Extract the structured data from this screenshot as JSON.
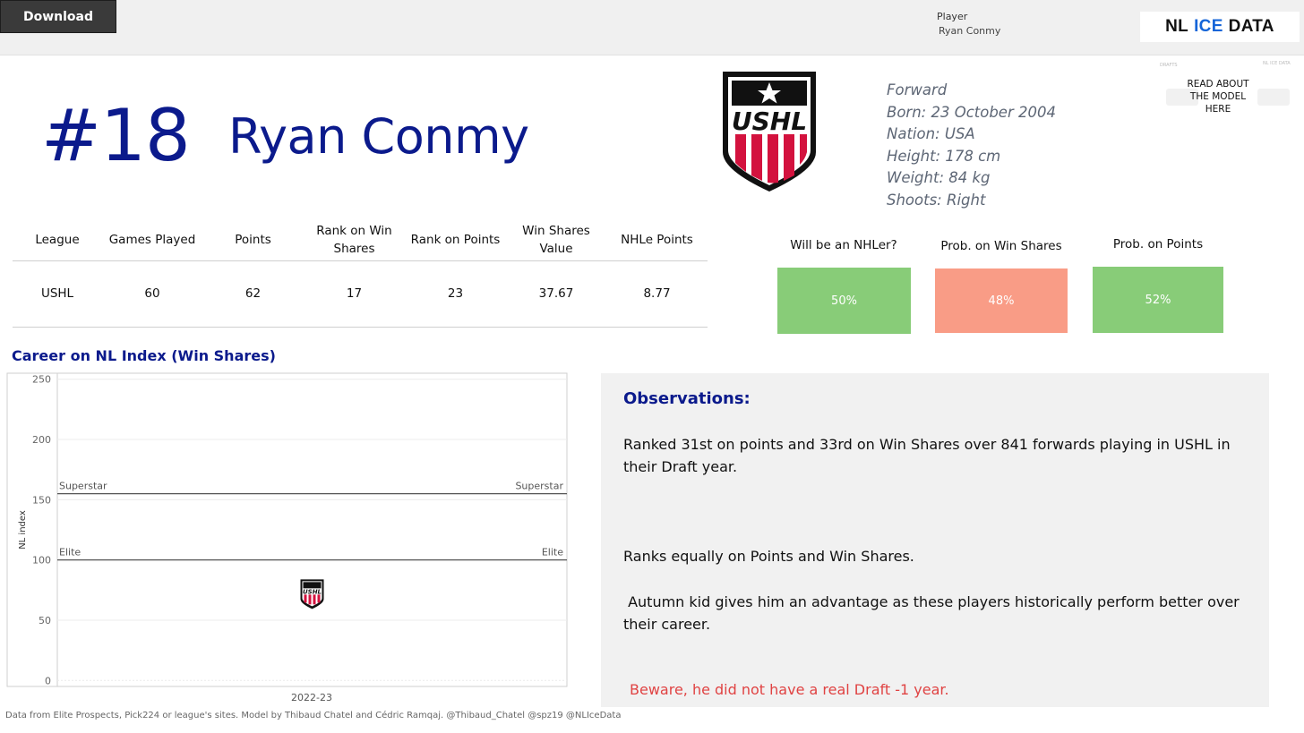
{
  "toolbar": {
    "download_label": "Download"
  },
  "filter": {
    "label": "Player",
    "value": "Ryan Conmy"
  },
  "brand": {
    "part1": "NL",
    "part2": "ICE",
    "part3": "DATA"
  },
  "player": {
    "number": "#18",
    "name": "Ryan Conmy",
    "league_logo_text": "USHL",
    "bio": [
      "Forward",
      "Born: 23 October 2004",
      "Nation: USA",
      "Height: 178 cm",
      "Weight: 84 kg",
      "Shoots: Right"
    ]
  },
  "read_about": {
    "label": "READ ABOUT THE MODEL HERE",
    "tiny_left": "DRAFTS",
    "tiny_right": "NL ICE DATA"
  },
  "stats": {
    "headers": [
      "League",
      "Games Played",
      "Points",
      "Rank on Win Shares",
      "Rank on Points",
      "Win Shares Value",
      "NHLe Points"
    ],
    "row": [
      "USHL",
      "60",
      "62",
      "17",
      "23",
      "37.67",
      "8.77"
    ]
  },
  "probabilities": [
    {
      "label": "Will be an NHLer?",
      "value": "50%",
      "color": "#88cc78"
    },
    {
      "label": "Prob. on Win Shares",
      "value": "48%",
      "color": "#f99c86"
    },
    {
      "label": "Prob. on Points",
      "value": "52%",
      "color": "#88cc78"
    }
  ],
  "career": {
    "title": "Career on NL Index (Win Shares)",
    "ylabel": "NL index",
    "yticks": [
      "250",
      "200",
      "150",
      "100",
      "50",
      "0"
    ],
    "xlabel": "2022-23",
    "ref_lines": [
      {
        "name": "Superstar",
        "value": 155
      },
      {
        "name": "Elite",
        "value": 100
      }
    ]
  },
  "chart_data": {
    "type": "scatter",
    "title": "Career on NL Index (Win Shares)",
    "ylabel": "NL index",
    "xlabel": "",
    "categories": [
      "2022-23"
    ],
    "values": [
      72
    ],
    "ylim": [
      -5,
      255
    ],
    "marker": "USHL logo",
    "reference_lines": [
      {
        "name": "Superstar",
        "value": 155
      },
      {
        "name": "Elite",
        "value": 100
      }
    ]
  },
  "observations": {
    "title": "Observations:",
    "p1": "Ranked 31st on points and 33rd on Win Shares over 841 forwards playing in USHL in their Draft year.",
    "p2": "Ranks equally on Points and Win Shares.",
    "p3": " Autumn kid gives him an advantage as these players historically perform better over their career.",
    "warning": "Beware, he did not have a real Draft -1 year."
  },
  "footer": "Data from Elite Prospects, Pick224 or league's sites. Model by Thibaud Chatel and Cédric Ramqaj. @Thibaud_Chatel @spz19 @NLIceData"
}
